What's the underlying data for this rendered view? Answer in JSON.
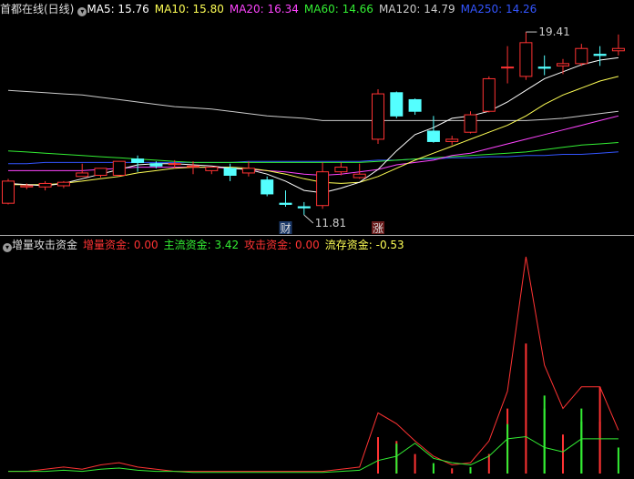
{
  "header": {
    "title": "首都在线(日线)",
    "ma": [
      {
        "label": "MA5: ",
        "value": "15.76",
        "color": "#ffffff"
      },
      {
        "label": "MA10: ",
        "value": "15.80",
        "color": "#ffff55"
      },
      {
        "label": "MA20: ",
        "value": "16.34",
        "color": "#ff44ff"
      },
      {
        "label": "MA60: ",
        "value": "14.66",
        "color": "#33ee33"
      },
      {
        "label": "MA120: ",
        "value": "14.79",
        "color": "#cccccc"
      },
      {
        "label": "MA250: ",
        "value": "14.26",
        "color": "#3355ff"
      }
    ]
  },
  "indicator": {
    "title": "增量攻击资金",
    "items": [
      {
        "label": "增量资金: ",
        "value": "0.00",
        "color": "#ff3333"
      },
      {
        "label": "主流资金: ",
        "value": "3.42",
        "color": "#33ee33"
      },
      {
        "label": "攻击资金: ",
        "value": "0.00",
        "color": "#ff3333"
      },
      {
        "label": "流存资金: ",
        "value": "-0.53",
        "color": "#ffff55"
      }
    ]
  },
  "chart_data": [
    {
      "type": "candlestick",
      "annotations": {
        "high": "19.41",
        "low": "11.81",
        "badges": [
          "财",
          "涨"
        ]
      },
      "candles": [
        {
          "o": 12.05,
          "h": 13.1,
          "c": 13.0,
          "l": 12.0
        },
        {
          "o": 12.75,
          "h": 12.9,
          "c": 12.8,
          "l": 12.65
        },
        {
          "o": 12.75,
          "h": 13.0,
          "c": 12.9,
          "l": 12.6
        },
        {
          "o": 12.8,
          "h": 13.0,
          "c": 12.95,
          "l": 12.7
        },
        {
          "o": 13.2,
          "h": 13.75,
          "c": 13.35,
          "l": 13.2
        },
        {
          "o": 13.25,
          "h": 13.55,
          "c": 13.55,
          "l": 13.15
        },
        {
          "o": 13.25,
          "h": 13.85,
          "c": 13.85,
          "l": 13.2
        },
        {
          "o": 13.95,
          "h": 14.1,
          "c": 13.8,
          "l": 13.4
        },
        {
          "o": 13.75,
          "h": 13.85,
          "c": 13.65,
          "l": 13.55
        },
        {
          "o": 13.75,
          "h": 13.9,
          "c": 13.75,
          "l": 13.55
        },
        {
          "o": 13.65,
          "h": 13.85,
          "c": 13.65,
          "l": 13.3
        },
        {
          "o": 13.45,
          "h": 13.6,
          "c": 13.6,
          "l": 13.3
        },
        {
          "o": 13.55,
          "h": 13.75,
          "c": 13.25,
          "l": 13.0
        },
        {
          "o": 13.35,
          "h": 13.85,
          "c": 13.55,
          "l": 13.2
        },
        {
          "o": 13.05,
          "h": 13.2,
          "c": 12.45,
          "l": 12.35
        },
        {
          "o": 12.05,
          "h": 12.6,
          "c": 12.0,
          "l": 11.9
        },
        {
          "o": 11.9,
          "h": 12.1,
          "c": 11.85,
          "l": 11.55
        },
        {
          "o": 11.95,
          "h": 13.8,
          "c": 13.4,
          "l": 11.81
        },
        {
          "o": 13.4,
          "h": 13.8,
          "c": 13.6,
          "l": 13.25
        },
        {
          "o": 13.15,
          "h": 13.75,
          "c": 13.3,
          "l": 13.1
        },
        {
          "o": 14.8,
          "h": 16.95,
          "c": 16.75,
          "l": 14.6
        },
        {
          "o": 16.8,
          "h": 16.85,
          "c": 15.8,
          "l": 15.7
        },
        {
          "o": 16.5,
          "h": 16.55,
          "c": 16.0,
          "l": 15.85
        },
        {
          "o": 15.15,
          "h": 15.8,
          "c": 14.7,
          "l": 14.65
        },
        {
          "o": 14.7,
          "h": 14.95,
          "c": 14.8,
          "l": 14.55
        },
        {
          "o": 15.1,
          "h": 16.0,
          "c": 15.85,
          "l": 15.05
        },
        {
          "o": 16.0,
          "h": 17.5,
          "c": 17.4,
          "l": 15.95
        },
        {
          "o": 17.9,
          "h": 18.8,
          "c": 17.9,
          "l": 17.2
        },
        {
          "o": 17.5,
          "h": 19.41,
          "c": 18.95,
          "l": 17.35
        },
        {
          "o": 17.9,
          "h": 18.4,
          "c": 17.85,
          "l": 17.55
        },
        {
          "o": 17.95,
          "h": 18.25,
          "c": 18.05,
          "l": 17.6
        },
        {
          "o": 18.05,
          "h": 18.9,
          "c": 18.7,
          "l": 17.95
        },
        {
          "o": 18.45,
          "h": 18.8,
          "c": 18.4,
          "l": 17.95
        },
        {
          "o": 18.6,
          "h": 19.3,
          "c": 18.7,
          "l": 18.4
        }
      ],
      "ma5": [
        12.9,
        12.85,
        12.8,
        12.9,
        13.1,
        13.3,
        13.5,
        13.7,
        13.75,
        13.75,
        13.7,
        13.65,
        13.55,
        13.5,
        13.3,
        13.0,
        12.6,
        12.5,
        12.7,
        12.95,
        13.5,
        14.3,
        15.0,
        15.3,
        15.7,
        15.8,
        16.0,
        16.4,
        16.9,
        17.4,
        17.7,
        18.0,
        18.2,
        18.3
      ],
      "ma10": [
        12.85,
        12.85,
        12.85,
        12.9,
        13.0,
        13.1,
        13.2,
        13.35,
        13.45,
        13.55,
        13.6,
        13.6,
        13.6,
        13.55,
        13.45,
        13.3,
        13.1,
        12.95,
        12.9,
        12.95,
        13.2,
        13.55,
        13.9,
        14.2,
        14.5,
        14.8,
        15.1,
        15.4,
        15.8,
        16.3,
        16.7,
        17.0,
        17.3,
        17.5
      ],
      "ma20": [
        13.45,
        13.45,
        13.45,
        13.45,
        13.45,
        13.5,
        13.55,
        13.6,
        13.6,
        13.6,
        13.6,
        13.6,
        13.55,
        13.5,
        13.45,
        13.4,
        13.3,
        13.25,
        13.3,
        13.4,
        13.5,
        13.7,
        13.8,
        13.9,
        14.1,
        14.2,
        14.4,
        14.6,
        14.8,
        15.0,
        15.2,
        15.4,
        15.6,
        15.8
      ],
      "ma60": [
        14.3,
        14.25,
        14.2,
        14.15,
        14.1,
        14.05,
        14.0,
        13.95,
        13.9,
        13.85,
        13.8,
        13.8,
        13.8,
        13.8,
        13.8,
        13.8,
        13.8,
        13.8,
        13.8,
        13.8,
        13.85,
        13.9,
        13.95,
        14.0,
        14.05,
        14.1,
        14.15,
        14.2,
        14.25,
        14.35,
        14.45,
        14.55,
        14.6,
        14.66
      ],
      "ma120": [
        16.9,
        16.85,
        16.8,
        16.75,
        16.7,
        16.6,
        16.5,
        16.4,
        16.3,
        16.2,
        16.15,
        16.1,
        16.0,
        15.9,
        15.8,
        15.75,
        15.7,
        15.6,
        15.6,
        15.6,
        15.6,
        15.6,
        15.6,
        15.6,
        15.6,
        15.6,
        15.6,
        15.6,
        15.6,
        15.65,
        15.7,
        15.8,
        15.9,
        16.0
      ],
      "ma250": [
        13.75,
        13.75,
        13.8,
        13.8,
        13.8,
        13.8,
        13.8,
        13.8,
        13.8,
        13.8,
        13.8,
        13.8,
        13.8,
        13.85,
        13.85,
        13.85,
        13.85,
        13.85,
        13.85,
        13.85,
        13.9,
        13.9,
        13.95,
        13.95,
        14.0,
        14.0,
        14.05,
        14.05,
        14.1,
        14.1,
        14.15,
        14.15,
        14.2,
        14.26
      ]
    },
    {
      "type": "bar+line",
      "series": [
        {
          "name": "增量资金",
          "values": [
            0.1,
            0.1,
            0.2,
            0.3,
            0.2,
            0.4,
            0.5,
            0.3,
            0.2,
            0.1,
            0.1,
            0.1,
            0.1,
            0.1,
            0.1,
            0.1,
            0.1,
            0.1,
            0.2,
            0.3,
            2.8,
            2.3,
            1.5,
            0.8,
            0.4,
            0.5,
            1.5,
            3.8,
            10.0,
            5.0,
            3.0,
            4.0,
            4.0,
            2.0
          ]
        },
        {
          "name": "主流资金",
          "values": [
            0.1,
            0.1,
            0.1,
            0.15,
            0.1,
            0.2,
            0.25,
            0.15,
            0.1,
            0.1,
            0.05,
            0.05,
            0.05,
            0.05,
            0.05,
            0.05,
            0.05,
            0.05,
            0.1,
            0.15,
            0.6,
            0.8,
            1.4,
            0.7,
            0.5,
            0.4,
            0.8,
            1.6,
            1.7,
            1.2,
            1.0,
            1.6,
            1.6,
            1.6
          ]
        },
        {
          "name": "攻击资金",
          "values": [
            0,
            0,
            0,
            0,
            0,
            0,
            0,
            0,
            0,
            0,
            0,
            0,
            0,
            0,
            0,
            0,
            0,
            0,
            0,
            0,
            0,
            1.5,
            0,
            0,
            0,
            0,
            0,
            3.0,
            0,
            0,
            0,
            0,
            4.0,
            0
          ]
        },
        {
          "name": "流存资金",
          "values": [
            0,
            0,
            0,
            0,
            0,
            0,
            0,
            0,
            0,
            0,
            0,
            0,
            0,
            0,
            0,
            0,
            0,
            0,
            0,
            0,
            0,
            0,
            0,
            0,
            0,
            0,
            0,
            0,
            0,
            3.6,
            0,
            3.0,
            0,
            0
          ]
        }
      ]
    }
  ]
}
